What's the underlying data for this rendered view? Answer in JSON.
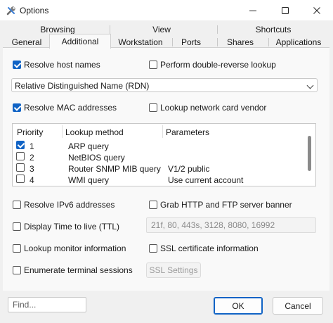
{
  "window": {
    "title": "Options",
    "app_icon": "wrench-icon",
    "controls": [
      "minimize-icon",
      "maximize-icon",
      "close-icon"
    ]
  },
  "tabs": {
    "row1": [
      "Browsing",
      "View",
      "Shortcuts"
    ],
    "row2": [
      "General",
      "Additional",
      "Workstation",
      "Ports",
      "Shares",
      "Applications"
    ],
    "active": "Additional"
  },
  "options": {
    "resolve_host_names": {
      "label": "Resolve host names",
      "checked": true
    },
    "double_reverse": {
      "label": "Perform double-reverse lookup",
      "checked": false
    },
    "name_format": "Relative Distinguished Name (RDN)",
    "resolve_mac": {
      "label": "Resolve MAC addresses",
      "checked": true
    },
    "lookup_vendor": {
      "label": "Lookup network card vendor",
      "checked": false
    },
    "resolve_ipv6": {
      "label": "Resolve IPv6 addresses",
      "checked": false
    },
    "grab_banner": {
      "label": "Grab HTTP and FTP server banner",
      "checked": false
    },
    "display_ttl": {
      "label": "Display Time to live (TTL)",
      "checked": false
    },
    "ports_value": "21f, 80, 443s, 3128, 8080, 16992",
    "lookup_monitor": {
      "label": "Lookup monitor information",
      "checked": false
    },
    "ssl_info": {
      "label": "SSL certificate information",
      "checked": false
    },
    "enumerate_sessions": {
      "label": "Enumerate terminal sessions",
      "checked": false
    },
    "ssl_settings_button": "SSL Settings"
  },
  "lookup_table": {
    "headers": [
      "Priority",
      "Lookup method",
      "Parameters"
    ],
    "rows": [
      {
        "checked": true,
        "priority": "1",
        "method": "ARP query",
        "params": ""
      },
      {
        "checked": false,
        "priority": "2",
        "method": "NetBIOS query",
        "params": ""
      },
      {
        "checked": false,
        "priority": "3",
        "method": "Router SNMP MIB query",
        "params": "V1/2 public"
      },
      {
        "checked": false,
        "priority": "4",
        "method": "WMI query",
        "params": "Use current account"
      }
    ]
  },
  "footer": {
    "find_placeholder": "Find...",
    "ok": "OK",
    "cancel": "Cancel"
  }
}
